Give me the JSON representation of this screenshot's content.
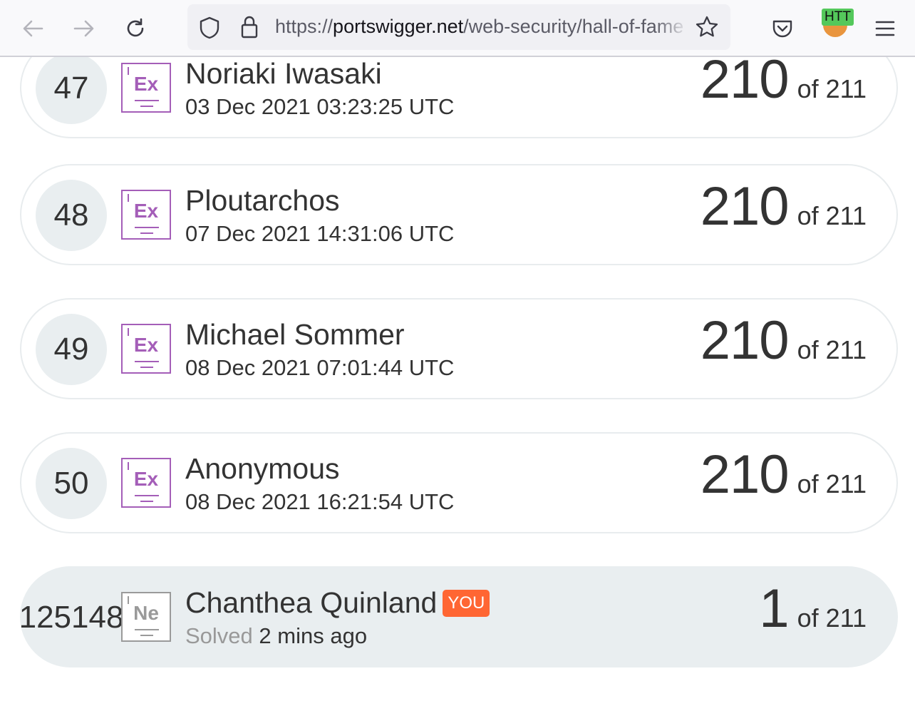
{
  "browser": {
    "url_scheme": "https://",
    "url_host": "portswigger.net",
    "url_path": "/web-security/hall-of-fame",
    "extension_label": "HTT"
  },
  "rows": [
    {
      "rank": "47",
      "badge": "Ex",
      "name": "Noriaki Iwasaki",
      "date": "03 Dec 2021 03:23:25 UTC",
      "score": "210",
      "total": "of 211"
    },
    {
      "rank": "48",
      "badge": "Ex",
      "name": "Ploutarchos",
      "date": "07 Dec 2021 14:31:06 UTC",
      "score": "210",
      "total": "of 211"
    },
    {
      "rank": "49",
      "badge": "Ex",
      "name": "Michael Sommer",
      "date": "08 Dec 2021 07:01:44 UTC",
      "score": "210",
      "total": "of 211"
    },
    {
      "rank": "50",
      "badge": "Ex",
      "name": "Anonymous",
      "date": "08 Dec 2021 16:21:54 UTC",
      "score": "210",
      "total": "of 211"
    }
  ],
  "you_row": {
    "rank": "125148",
    "badge": "Ne",
    "name": "Chanthea Quinland",
    "you_label": "YOU",
    "solved_label": "Solved",
    "solved_time": "2 mins ago",
    "score": "1",
    "total": "of 211"
  },
  "colors": {
    "expert_badge": "#a45eb8",
    "newbie_badge": "#9a9a9a",
    "you_badge": "#ff6633",
    "highlight_row": "#e9eef0"
  }
}
